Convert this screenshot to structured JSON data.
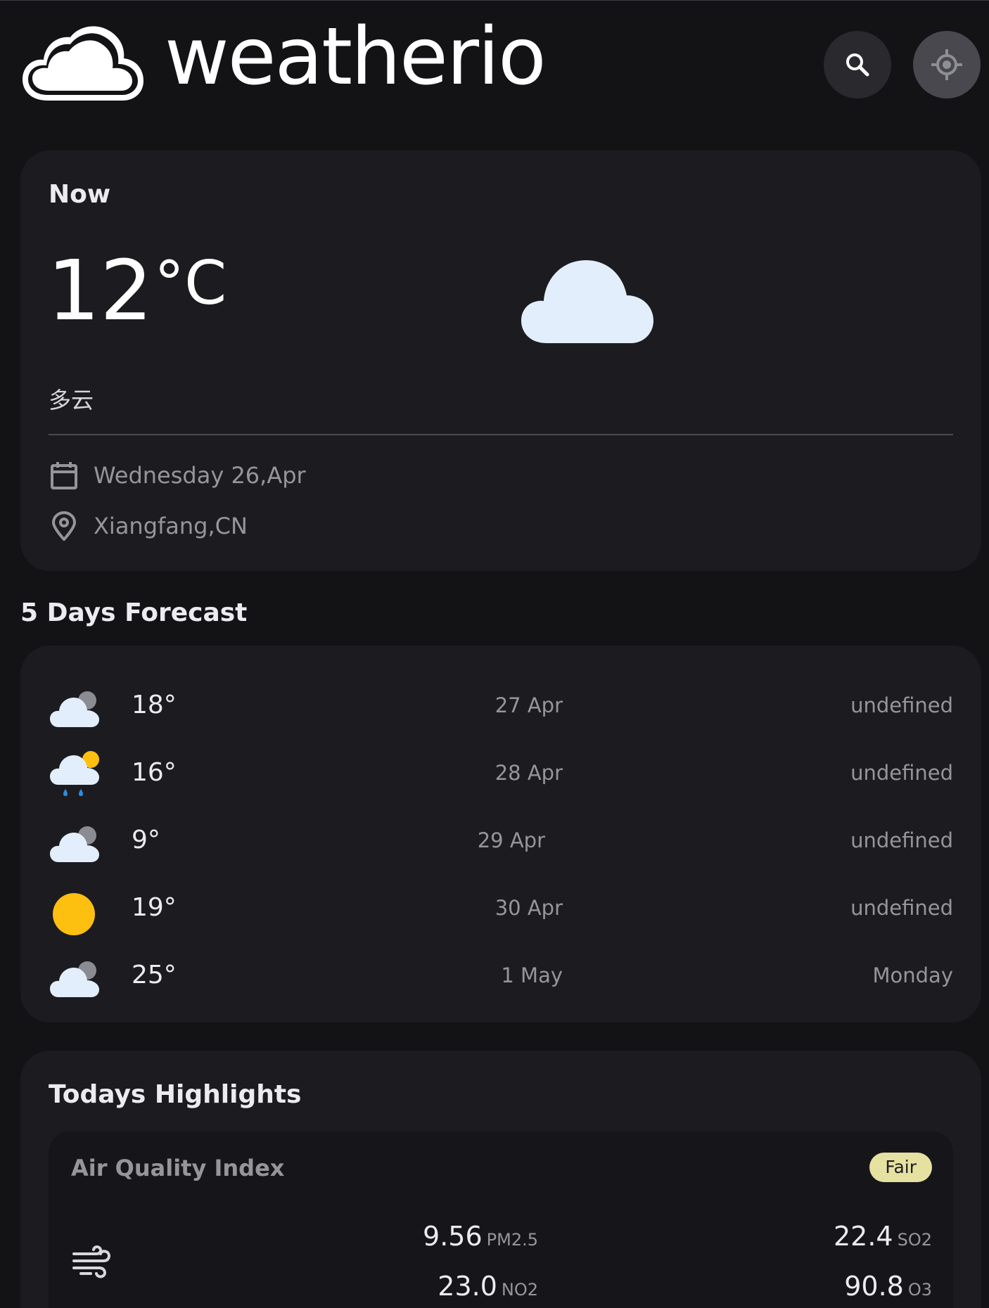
{
  "app": {
    "name": "weatherio",
    "logo_icon": "cloud-icon",
    "search_icon": "search-icon",
    "location_icon": "current-location-icon"
  },
  "now": {
    "title": "Now",
    "temperature": "12",
    "unit": "°C",
    "condition": "多云",
    "condition_icon": "cloud-icon",
    "date": "Wednesday 26,Apr",
    "location": "Xiangfang,CN"
  },
  "forecast": {
    "heading": "5 Days Forecast",
    "days": [
      {
        "icon": "cloudy-icon",
        "temp": "18°",
        "date": "27 Apr",
        "day": "undefined"
      },
      {
        "icon": "rain-sun-icon",
        "temp": "16°",
        "date": "28 Apr",
        "day": "undefined"
      },
      {
        "icon": "cloudy-icon",
        "temp": "9°",
        "date": "29 Apr",
        "day": "undefined"
      },
      {
        "icon": "sun-icon",
        "temp": "19°",
        "date": "30 Apr",
        "day": "undefined"
      },
      {
        "icon": "cloudy-icon",
        "temp": "25°",
        "date": "1 May",
        "day": "Monday"
      }
    ]
  },
  "highlights": {
    "title": "Todays Highlights",
    "aqi": {
      "title": "Air Quality Index",
      "badge": "Fair",
      "badge_color": "#e5e1a0",
      "pm25": {
        "value": "9.56",
        "label": "PM2.5"
      },
      "so2": {
        "value": "22.4",
        "label": "SO2"
      },
      "no2": {
        "value": "23.0",
        "label": "NO2"
      },
      "o3": {
        "value": "90.8",
        "label": "O3"
      }
    }
  },
  "colors": {
    "background": "#131316",
    "card": "#1c1c20",
    "muted_text": "#95959c",
    "cloud": "#e2eefb",
    "sun": "#fdbf10",
    "rain": "#2a8fe0"
  }
}
